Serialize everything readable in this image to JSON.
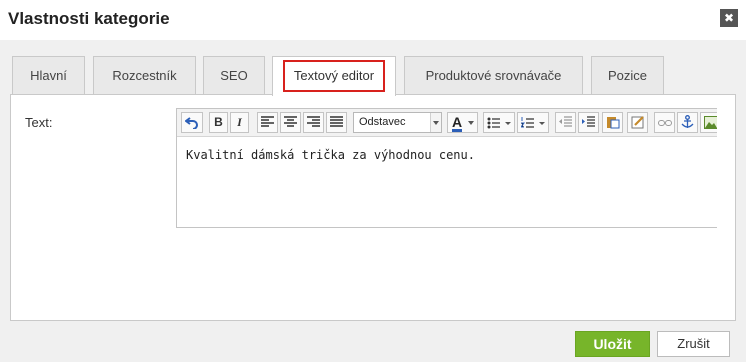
{
  "dialog": {
    "title": "Vlastnosti kategorie",
    "close_symbol": "✖"
  },
  "tabs": [
    {
      "label": "Hlavní",
      "active": false
    },
    {
      "label": "Rozcestník",
      "active": false
    },
    {
      "label": "SEO",
      "active": false
    },
    {
      "label": "Textový editor",
      "active": true
    },
    {
      "label": "Produktové srovnávače",
      "active": false
    },
    {
      "label": "Pozice",
      "active": false
    }
  ],
  "form": {
    "text_label": "Text:"
  },
  "editor": {
    "toolbar": {
      "undo_icon": "undo-icon",
      "bold_label": "B",
      "italic_label": "I",
      "align_icons": [
        "align-left-icon",
        "align-center-icon",
        "align-right-icon",
        "align-justify-icon"
      ],
      "format_select": "Odstavec",
      "font_color_label": "A",
      "accent_color": "#2c5fb8",
      "highlight_color": "#d8211d"
    },
    "content": "Kvalitní dámská trička za výhodnou cenu."
  },
  "footer": {
    "save_label": "Uložit",
    "cancel_label": "Zrušit",
    "save_color": "#77b52a"
  }
}
